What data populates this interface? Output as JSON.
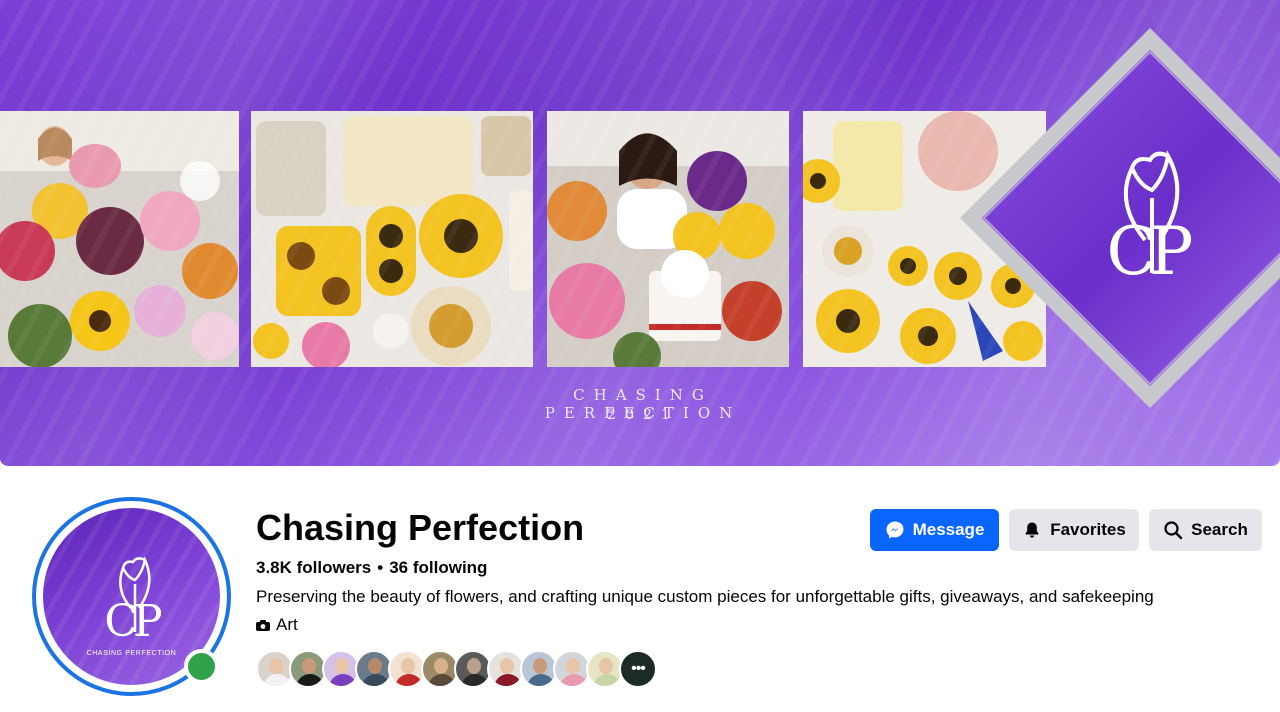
{
  "cover": {
    "caption_line1": "CHASING PERFECTION",
    "caption_line2": "2021",
    "logo_monogram": "CP",
    "photos": [
      "flowers-portrait-photo",
      "resin-sunflower-trays-photo",
      "woman-with-bouquets-photo",
      "resin-flower-pieces-photo"
    ]
  },
  "profile": {
    "name": "Chasing Perfection",
    "avatar_monogram": "CP",
    "avatar_caption": "CHASING PERFECTION",
    "followers": "3.8K followers",
    "separator": "•",
    "following": "36 following",
    "bio": "Preserving the beauty of flowers, and crafting unique custom pieces for unforgettable gifts, giveaways, and safekeeping",
    "category": "Art",
    "online": true
  },
  "actions": {
    "message_label": "Message",
    "favorites_label": "Favorites",
    "search_label": "Search"
  },
  "friends": {
    "more_glyph": "•••",
    "count_shown": 12
  },
  "colors": {
    "accent": "#0866ff",
    "ring": "#1b74e4",
    "online": "#31a24c",
    "cover_purple": "#7a3fd6",
    "button_grey": "#e4e6eb"
  }
}
